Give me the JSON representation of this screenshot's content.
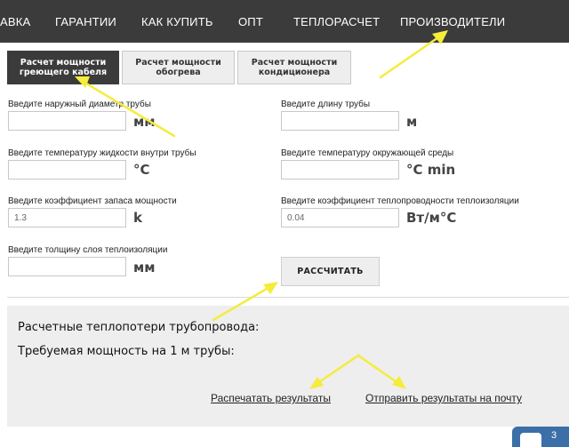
{
  "nav": {
    "items": [
      "АВКА",
      "ГАРАНТИИ",
      "КАК КУПИТЬ",
      "ОПТ",
      "ТЕПЛОРАСЧЕТ",
      "ПРОИЗВОДИТЕЛИ"
    ],
    "background": "#3b3b3b"
  },
  "tabs": [
    {
      "line1": "Расчет мощности",
      "line2": "греющего кабеля",
      "active": true
    },
    {
      "line1": "Расчет мощности",
      "line2": "обогрева",
      "active": false
    },
    {
      "line1": "Расчет мощности",
      "line2": "кондиционера",
      "active": false
    }
  ],
  "form": {
    "outer_diameter": {
      "label": "Введите наружный диаметр трубы",
      "value": "",
      "unit": "мм"
    },
    "pipe_length": {
      "label": "Введите длину трубы",
      "value": "",
      "unit": "м"
    },
    "liquid_temp": {
      "label": "Введите температуру жидкости внутри трубы",
      "value": "",
      "unit": "°C"
    },
    "ambient_temp": {
      "label": "Введите температуру окружающей среды",
      "value": "",
      "unit": "°C min"
    },
    "power_reserve": {
      "label": "Введите коэффициент запаса мощности",
      "value": "1.3",
      "unit": "k"
    },
    "conductivity": {
      "label": "Введите коэффициент теплопроводности теплоизоляции",
      "value": "0.04",
      "unit": "Вт/м°С"
    },
    "insulation": {
      "label": "Введите толщину слоя теплоизоляции",
      "value": "",
      "unit": "мм"
    },
    "calculate_label": "РАССЧИТАТЬ"
  },
  "results": {
    "heat_loss_label": "Расчетные теплопотери трубопровода:",
    "power_label": "Требуемая мощность на 1 м трубы:",
    "print_link": "Распечатать результаты",
    "email_link": "Отправить результаты на почту"
  },
  "widget": {
    "text": "3",
    "icon": "chat-icon",
    "color": "#3c6fa8"
  },
  "annotation_color": "#f5ec3b"
}
